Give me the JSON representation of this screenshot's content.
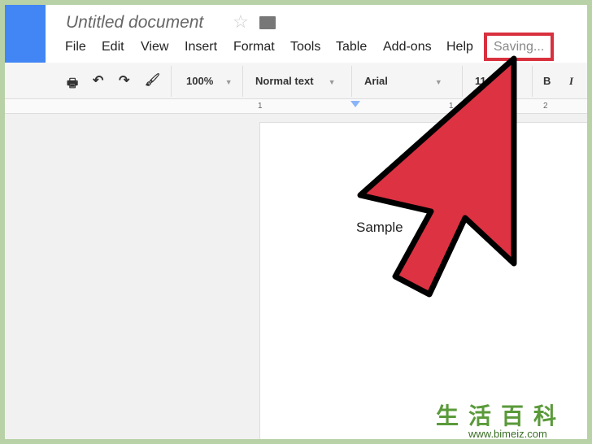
{
  "document": {
    "title": "Untitled document",
    "status": "Saving...",
    "body_text": "Sample"
  },
  "menu": [
    "File",
    "Edit",
    "View",
    "Insert",
    "Format",
    "Tools",
    "Table",
    "Add-ons",
    "Help"
  ],
  "toolbar": {
    "zoom": "100%",
    "style": "Normal text",
    "font": "Arial",
    "size": "11",
    "bold": "B",
    "italic": "I"
  },
  "ruler": {
    "marks": [
      "1",
      "1",
      "2"
    ]
  },
  "watermark": {
    "chinese": "生活百科",
    "url": "www.bimeiz.com"
  },
  "colors": {
    "arrow": "#dc3242",
    "highlight": "#d9303e",
    "brand": "#4285f4",
    "border": "#b9d1a6"
  }
}
